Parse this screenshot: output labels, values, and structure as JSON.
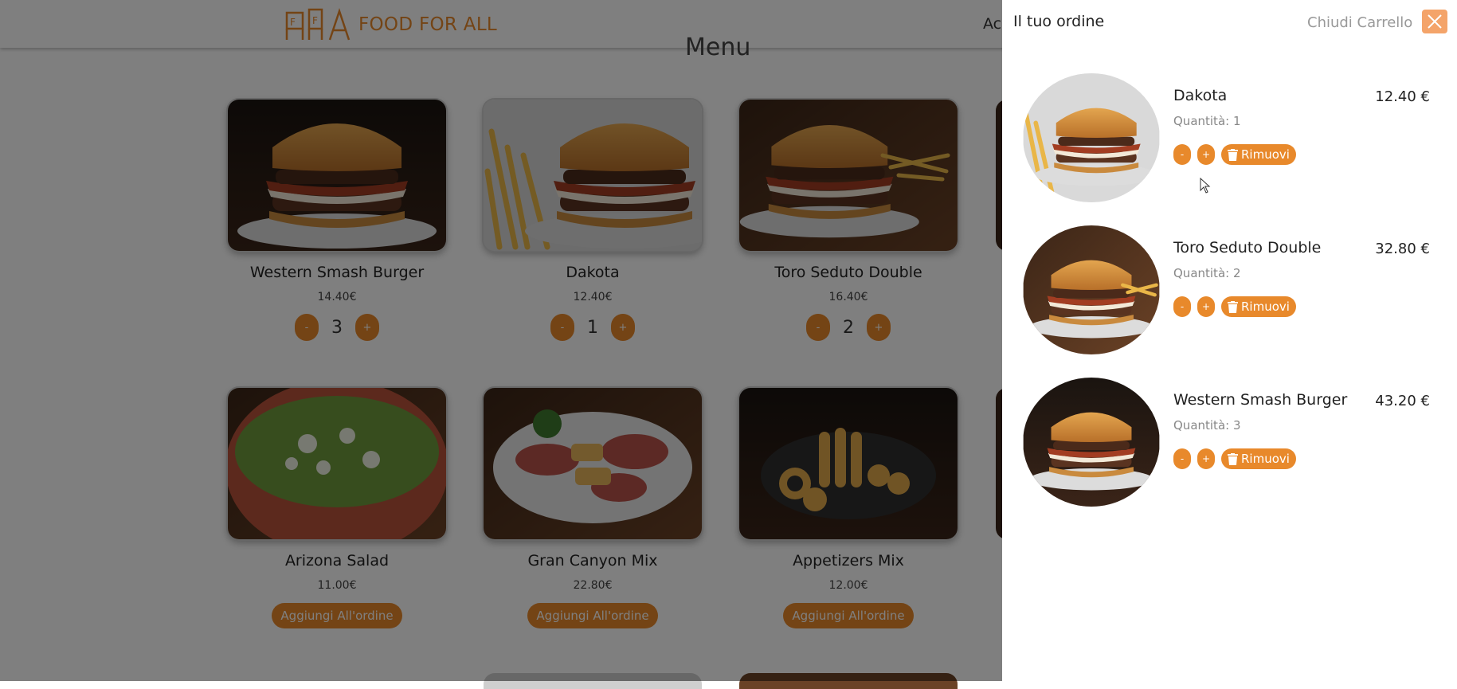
{
  "header": {
    "logo_text": "FOOD FOR ALL",
    "nav_partial": "Ac",
    "menu_heading": "Menu"
  },
  "menu": {
    "items": [
      {
        "name": "Western Smash Burger",
        "price": "14.40€",
        "quantity": "3",
        "minus": "-",
        "plus": "+"
      },
      {
        "name": "Dakota",
        "price": "12.40€",
        "quantity": "1",
        "minus": "-",
        "plus": "+"
      },
      {
        "name": "Toro Seduto Double",
        "price": "16.40€",
        "quantity": "2",
        "minus": "-",
        "plus": "+"
      },
      {
        "name": "Arizona Salad",
        "price": "11.00€",
        "add_label": "Aggiungi All'ordine"
      },
      {
        "name": "Gran Canyon Mix",
        "price": "22.80€",
        "add_label": "Aggiungi All'ordine"
      },
      {
        "name": "Appetizers Mix",
        "price": "12.00€",
        "add_label": "Aggiungi All'ordine"
      }
    ]
  },
  "cart": {
    "title": "Il tuo ordine",
    "close_label": "Chiudi Carrello",
    "items": [
      {
        "name": "Dakota",
        "quantity_label": "Quantità: 1",
        "price": "12.40 €",
        "minus": "-",
        "plus": "+",
        "remove_label": "Rimuovi"
      },
      {
        "name": "Toro Seduto Double",
        "quantity_label": "Quantità: 2",
        "price": "32.80 €",
        "minus": "-",
        "plus": "+",
        "remove_label": "Rimuovi"
      },
      {
        "name": "Western Smash Burger",
        "quantity_label": "Quantità: 3",
        "price": "43.20 €",
        "minus": "-",
        "plus": "+",
        "remove_label": "Rimuovi"
      }
    ]
  },
  "colors": {
    "accent": "#e8892b",
    "close_button": "#f4a46a",
    "overlay": "rgba(0,0,0,0.5)"
  },
  "icons": [
    "logo-icon",
    "close-icon",
    "trash-icon",
    "mouse-cursor-icon"
  ]
}
